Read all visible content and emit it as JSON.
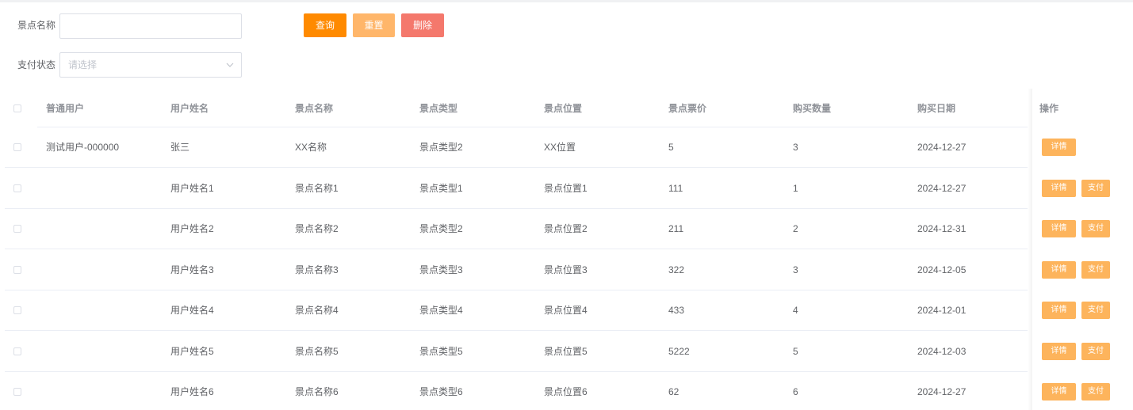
{
  "search": {
    "name_label": "景点名称",
    "name_value": "",
    "status_label": "支付状态",
    "status_placeholder": "请选择"
  },
  "toolbar": {
    "query_label": "查询",
    "reset_label": "重置",
    "delete_label": "删除"
  },
  "colors": {
    "query": "#ff8a00",
    "reset": "#ffb66a",
    "delete": "#f4786c",
    "row_button": "#fdb45c"
  },
  "table": {
    "headers": {
      "user": "普通用户",
      "username": "用户姓名",
      "spot_name": "景点名称",
      "spot_type": "景点类型",
      "spot_location": "景点位置",
      "price": "景点票价",
      "quantity": "购买数量",
      "date": "购买日期",
      "actions": "操作"
    },
    "rows": [
      {
        "user": "测试用户-000000",
        "username": "张三",
        "spot_name": "XX名称",
        "spot_type": "景点类型2",
        "spot_location": "XX位置",
        "price": "5",
        "quantity": "3",
        "date": "2024-12-27",
        "detail": "详情",
        "pay": ""
      },
      {
        "user": "",
        "username": "用户姓名1",
        "spot_name": "景点名称1",
        "spot_type": "景点类型1",
        "spot_location": "景点位置1",
        "price": "111",
        "quantity": "1",
        "date": "2024-12-27",
        "detail": "详情",
        "pay": "支付"
      },
      {
        "user": "",
        "username": "用户姓名2",
        "spot_name": "景点名称2",
        "spot_type": "景点类型2",
        "spot_location": "景点位置2",
        "price": "211",
        "quantity": "2",
        "date": "2024-12-31",
        "detail": "详情",
        "pay": "支付"
      },
      {
        "user": "",
        "username": "用户姓名3",
        "spot_name": "景点名称3",
        "spot_type": "景点类型3",
        "spot_location": "景点位置3",
        "price": "322",
        "quantity": "3",
        "date": "2024-12-05",
        "detail": "详情",
        "pay": "支付"
      },
      {
        "user": "",
        "username": "用户姓名4",
        "spot_name": "景点名称4",
        "spot_type": "景点类型4",
        "spot_location": "景点位置4",
        "price": "433",
        "quantity": "4",
        "date": "2024-12-01",
        "detail": "详情",
        "pay": "支付"
      },
      {
        "user": "",
        "username": "用户姓名5",
        "spot_name": "景点名称5",
        "spot_type": "景点类型5",
        "spot_location": "景点位置5",
        "price": "5222",
        "quantity": "5",
        "date": "2024-12-03",
        "detail": "详情",
        "pay": "支付"
      },
      {
        "user": "",
        "username": "用户姓名6",
        "spot_name": "景点名称6",
        "spot_type": "景点类型6",
        "spot_location": "景点位置6",
        "price": "62",
        "quantity": "6",
        "date": "2024-12-27",
        "detail": "详情",
        "pay": "支付"
      }
    ]
  }
}
